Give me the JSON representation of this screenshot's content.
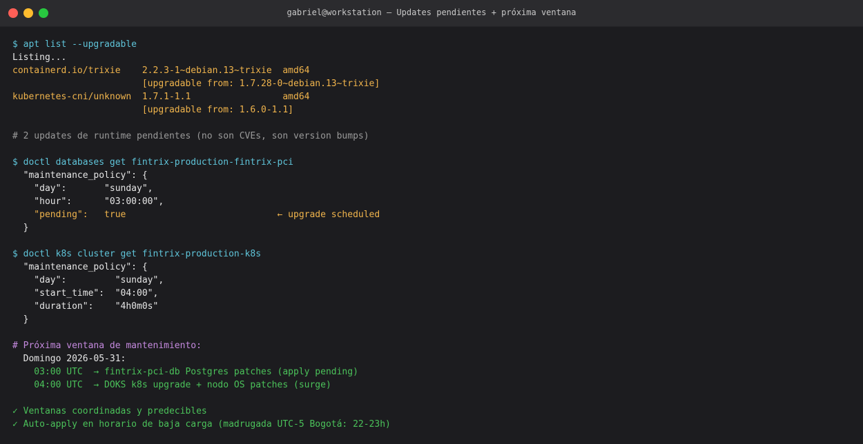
{
  "window": {
    "title": "gabriel@workstation — Updates pendientes + próxima ventana"
  },
  "colors": {
    "prompt": "#5fc4d9",
    "highlight": "#f0b44c",
    "comment": "#9a9a9a",
    "section_comment": "#c58adf",
    "success": "#4bc25a",
    "text": "#e6e6e6",
    "background": "#1c1c1f"
  },
  "terminal": {
    "lines": [
      {
        "text": "$ apt list --upgradable",
        "style": "cyan"
      },
      {
        "text": "Listing...",
        "style": "white"
      },
      {
        "text": "containerd.io/trixie    2.2.3-1~debian.13~trixie  amd64",
        "style": "orange"
      },
      {
        "text": "                        [upgradable from: 1.7.28-0~debian.13~trixie]",
        "style": "orange"
      },
      {
        "text": "kubernetes-cni/unknown  1.7.1-1.1                 amd64",
        "style": "orange"
      },
      {
        "text": "                        [upgradable from: 1.6.0-1.1]",
        "style": "orange"
      },
      {
        "text": "",
        "style": "white"
      },
      {
        "text": "# 2 updates de runtime pendientes (no son CVEs, son version bumps)",
        "style": "gray"
      },
      {
        "text": "",
        "style": "white"
      },
      {
        "text": "$ doctl databases get fintrix-production-fintrix-pci",
        "style": "cyan"
      },
      {
        "text": "  \"maintenance_policy\": {",
        "style": "white"
      },
      {
        "text": "    \"day\":       \"sunday\",",
        "style": "white"
      },
      {
        "text": "    \"hour\":      \"03:00:00\",",
        "style": "white"
      },
      {
        "text": "    \"pending\":   true                            ← upgrade scheduled",
        "style": "orange"
      },
      {
        "text": "  }",
        "style": "white"
      },
      {
        "text": "",
        "style": "white"
      },
      {
        "text": "$ doctl k8s cluster get fintrix-production-k8s",
        "style": "cyan"
      },
      {
        "text": "  \"maintenance_policy\": {",
        "style": "white"
      },
      {
        "text": "    \"day\":         \"sunday\",",
        "style": "white"
      },
      {
        "text": "    \"start_time\":  \"04:00\",",
        "style": "white"
      },
      {
        "text": "    \"duration\":    \"4h0m0s\"",
        "style": "white"
      },
      {
        "text": "  }",
        "style": "white"
      },
      {
        "text": "",
        "style": "white"
      },
      {
        "text": "# Próxima ventana de mantenimiento:",
        "style": "purple"
      },
      {
        "text": "  Domingo 2026-05-31:",
        "style": "white"
      },
      {
        "text": "    03:00 UTC  → fintrix-pci-db Postgres patches (apply pending)",
        "style": "green"
      },
      {
        "text": "    04:00 UTC  → DOKS k8s upgrade + nodo OS patches (surge)",
        "style": "green"
      },
      {
        "text": "",
        "style": "white"
      },
      {
        "text": "✓ Ventanas coordinadas y predecibles",
        "style": "green"
      },
      {
        "text": "✓ Auto-apply en horario de baja carga (madrugada UTC-5 Bogotá: 22-23h)",
        "style": "green"
      }
    ]
  }
}
